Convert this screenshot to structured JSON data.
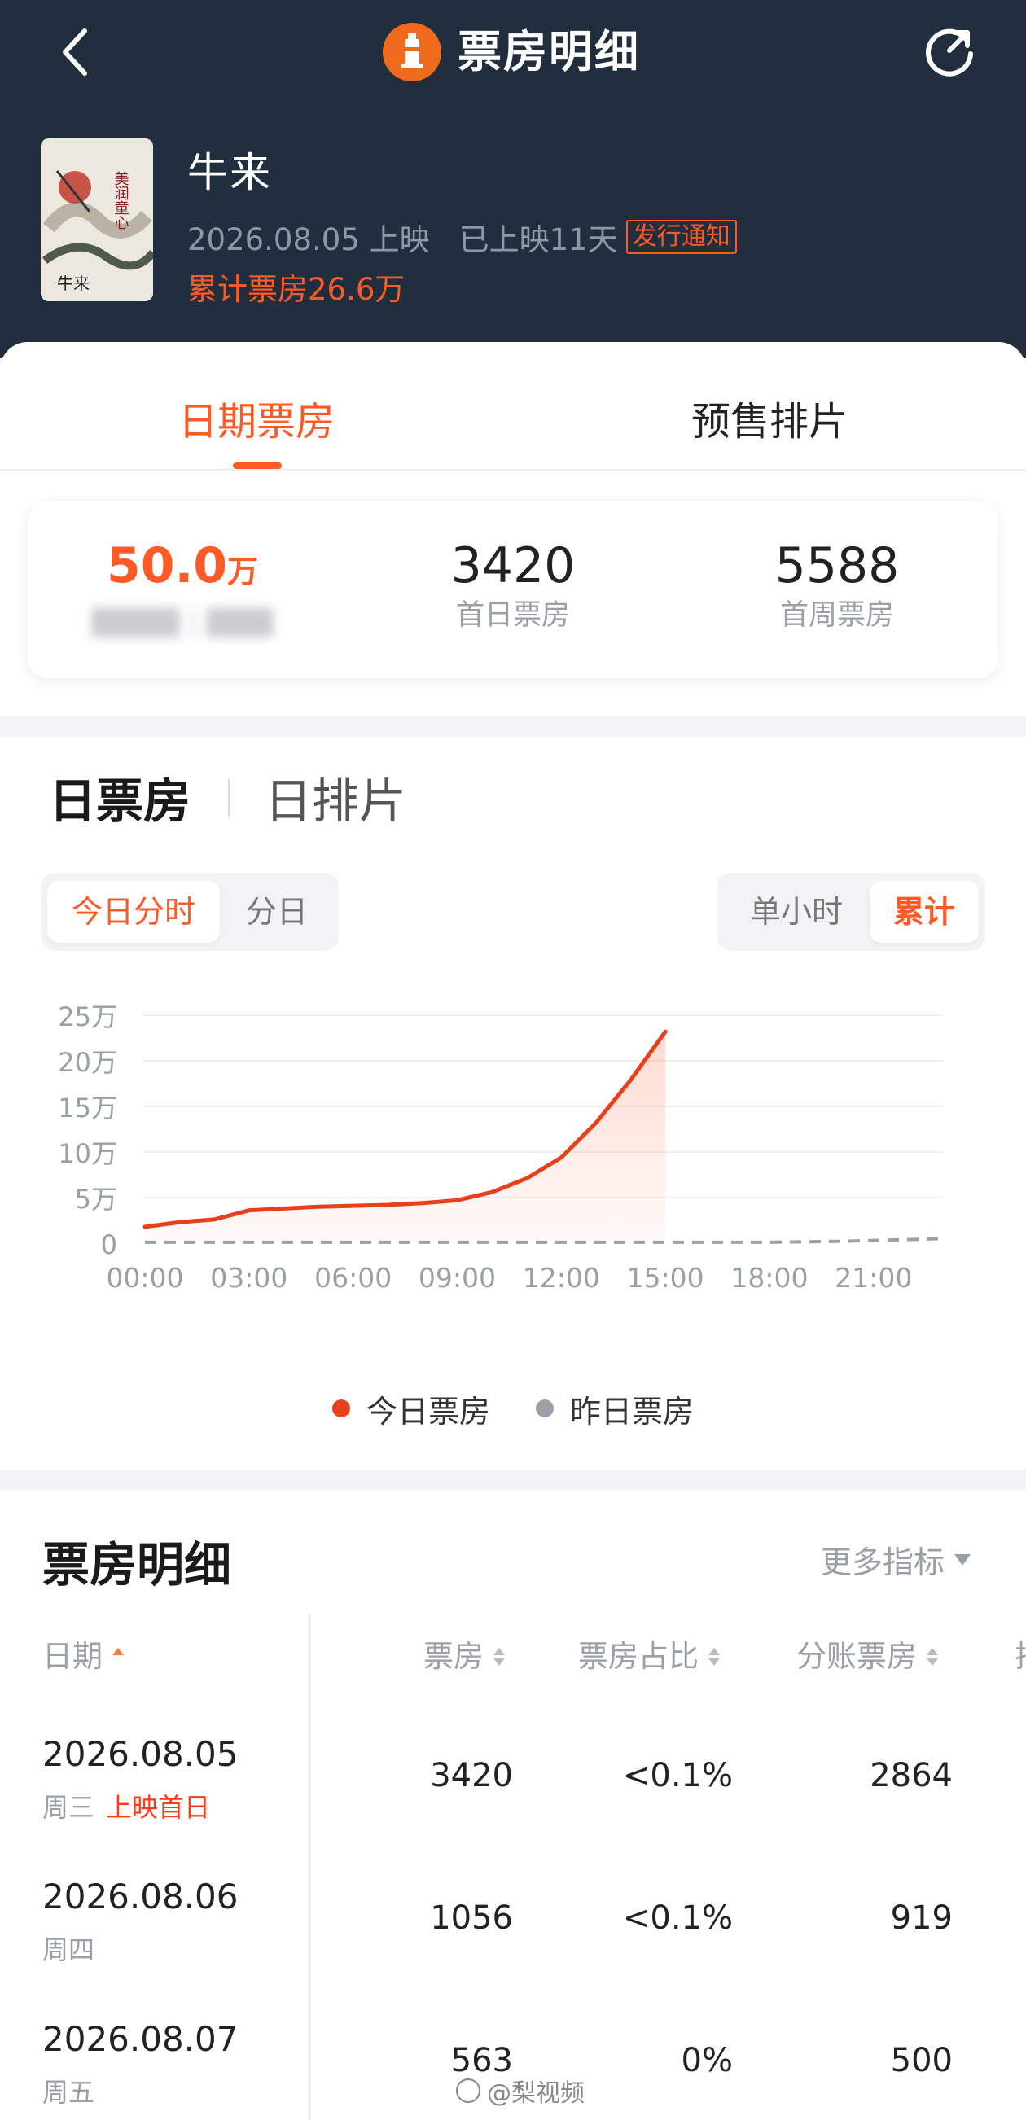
{
  "header": {
    "title": "票房明细",
    "icons": {
      "back": "chevron-left-icon",
      "refresh": "refresh-icon",
      "logo": "lighthouse-logo"
    }
  },
  "movie": {
    "title": "牛来",
    "release_date": "2026.08.05 上映",
    "days_showing": "已上映11天",
    "issue_tag": "发行通知",
    "total_gross": "累计票房26.6万",
    "poster_text": "美润童心"
  },
  "tabs": {
    "date_box_office": "日期票房",
    "presale": "预售排片",
    "active": "日期票房"
  },
  "stats": [
    {
      "value": "50.0",
      "unit": "万",
      "label": ""
    },
    {
      "value": "3420",
      "unit": "",
      "label": "首日票房"
    },
    {
      "value": "5588",
      "unit": "",
      "label": "首周票房"
    }
  ],
  "chart_section": {
    "tab_daily_gross": "日票房",
    "tab_daily_schedule": "日排片",
    "seg_today_hourly": "今日分时",
    "seg_by_day": "分日",
    "seg_single_hour": "单小时",
    "seg_cumulative": "累计"
  },
  "chart_data": {
    "type": "line",
    "x_ticks": [
      "00:00",
      "03:00",
      "06:00",
      "09:00",
      "12:00",
      "15:00",
      "18:00",
      "21:00"
    ],
    "y_ticks": [
      "0",
      "5万",
      "10万",
      "15万",
      "20万",
      "25万"
    ],
    "ylim": [
      0,
      25
    ],
    "y_unit": "万",
    "xlim": [
      0,
      23
    ],
    "series": [
      {
        "name": "今日票房",
        "color": "#e8401c",
        "x": [
          0,
          1,
          2,
          3,
          4,
          5,
          6,
          7,
          8,
          9,
          10,
          11,
          12,
          13,
          14,
          15
        ],
        "y": [
          1.8,
          2.3,
          2.6,
          3.6,
          3.8,
          4.0,
          4.1,
          4.2,
          4.4,
          4.7,
          5.6,
          7.1,
          9.4,
          13.2,
          17.9,
          23.2
        ]
      },
      {
        "name": "昨日票房",
        "color": "#9aa0a8",
        "x": [
          0,
          3,
          6,
          9,
          12,
          15,
          18,
          20,
          21,
          22,
          23
        ],
        "y": [
          0.1,
          0.1,
          0.1,
          0.1,
          0.1,
          0.1,
          0.1,
          0.2,
          0.3,
          0.4,
          0.5
        ]
      }
    ],
    "legend": [
      "今日票房",
      "昨日票房"
    ],
    "grid": true,
    "legend_position": "bottom"
  },
  "detail": {
    "title": "票房明细",
    "more_metrics": "更多指标",
    "columns": [
      "日期",
      "票房",
      "票房占比",
      "分账票房",
      "排"
    ],
    "rows": [
      {
        "date": "2026.08.05",
        "weekday": "周三",
        "tag": "上映首日",
        "gross": "3420",
        "share": "<0.1%",
        "split": "2864"
      },
      {
        "date": "2026.08.06",
        "weekday": "周四",
        "tag": "",
        "gross": "1056",
        "share": "<0.1%",
        "split": "919"
      },
      {
        "date": "2026.08.07",
        "weekday": "周五",
        "tag": "",
        "gross": "563",
        "share": "0%",
        "split": "500"
      }
    ]
  },
  "watermark": "@梨视频",
  "colors": {
    "accent": "#ff5a26",
    "header_bg": "#212e3d",
    "line_today": "#e8401c",
    "line_yesterday": "#9aa0a8"
  }
}
